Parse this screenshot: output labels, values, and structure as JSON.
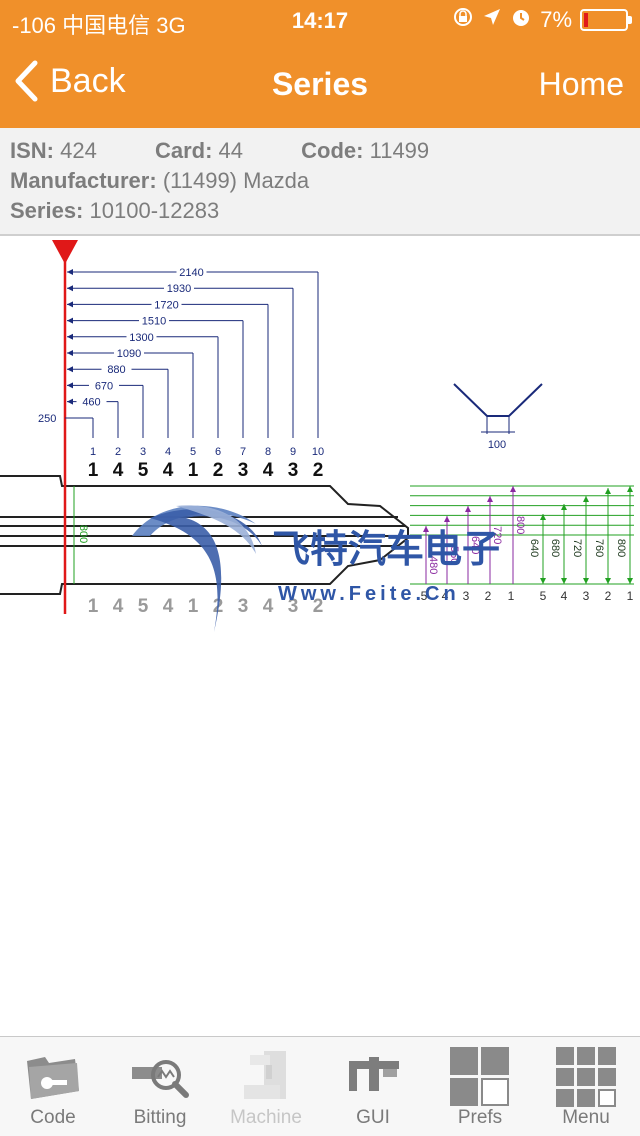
{
  "status": {
    "carrier": "-106 中国电信  3G",
    "time": "14:17",
    "battery": "7%"
  },
  "nav": {
    "back_label": "Back",
    "title": "Series",
    "home_label": "Home"
  },
  "info": {
    "isn_label": "ISN:",
    "isn_value": "424",
    "card_label": "Card:",
    "card_value": "44",
    "code_label": "Code:",
    "code_value": "11499",
    "manufacturer_label": "Manufacturer:",
    "manufacturer_value": "(11499) Mazda",
    "series_label": "Series:",
    "series_value": "10100-12283"
  },
  "diagram": {
    "shoulder_offset": "250",
    "spacing_labels": [
      "460",
      "670",
      "880",
      "1090",
      "1300",
      "1510",
      "1720",
      "1930",
      "2140"
    ],
    "position_numbers": [
      "1",
      "2",
      "3",
      "4",
      "5",
      "6",
      "7",
      "8",
      "9",
      "10"
    ],
    "cut_code_top": [
      "1",
      "4",
      "5",
      "4",
      "1",
      "2",
      "3",
      "4",
      "3",
      "2"
    ],
    "cut_code_bottom": [
      "1",
      "4",
      "5",
      "4",
      "1",
      "2",
      "3",
      "4",
      "3",
      "2"
    ],
    "blade_width": "800",
    "cutter_width": "100",
    "purple_depths": [
      "480",
      "560",
      "640",
      "720",
      "800"
    ],
    "purple_depth_numbers": [
      "5",
      "4",
      "3",
      "2",
      "1"
    ],
    "green_depths": [
      "640",
      "680",
      "720",
      "760",
      "800"
    ],
    "green_depth_numbers": [
      "5",
      "4",
      "3",
      "2",
      "1"
    ],
    "watermark_cn": "飞特汽车电子",
    "watermark_url": "Www.Feite.Cn"
  },
  "tabs": [
    {
      "label": "Code",
      "icon": "folder-key-icon",
      "enabled": true
    },
    {
      "label": "Bitting",
      "icon": "key-magnifier-icon",
      "enabled": true
    },
    {
      "label": "Machine",
      "icon": "machine-icon",
      "enabled": false
    },
    {
      "label": "GUI",
      "icon": "caliper-icon",
      "enabled": true
    },
    {
      "label": "Prefs",
      "icon": "prefs-grid-icon",
      "enabled": true
    },
    {
      "label": "Menu",
      "icon": "menu-grid-icon",
      "enabled": true
    }
  ]
}
